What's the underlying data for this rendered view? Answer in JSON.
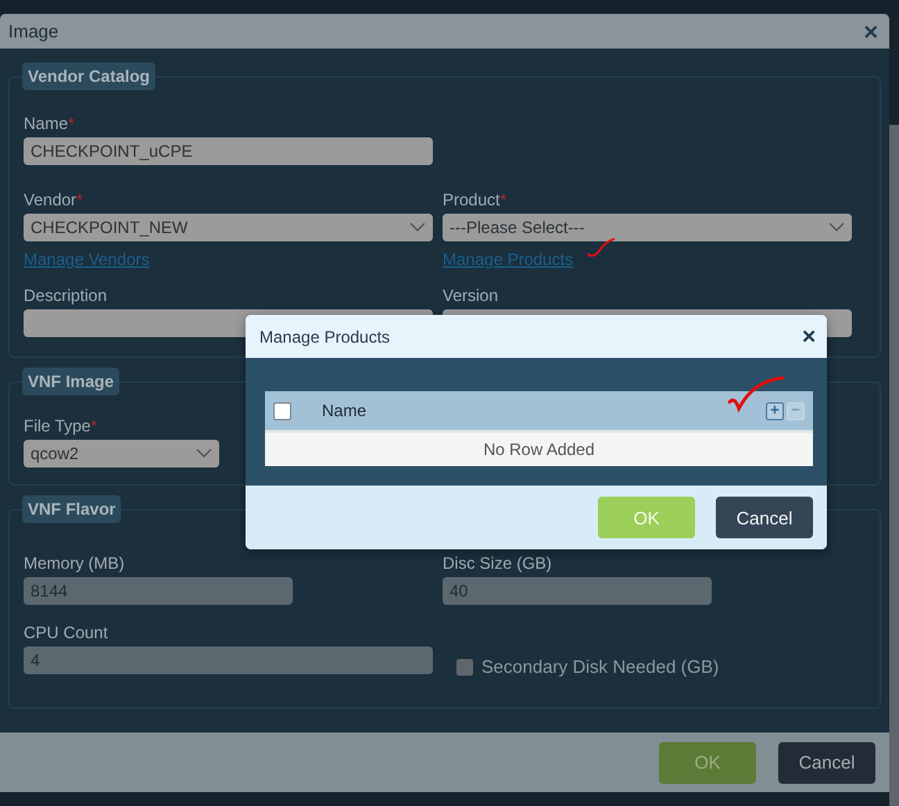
{
  "dialog": {
    "title": "Image",
    "close": "×",
    "sections": [
      {
        "legend": "Vendor Catalog",
        "rows": [
          [
            {
              "kind": "input",
              "label": "Name",
              "required_mark": "*",
              "value": "CHECKPOINT_uCPE"
            }
          ],
          [
            {
              "kind": "select",
              "label": "Vendor",
              "required_mark": "*",
              "value": "CHECKPOINT_NEW",
              "link": "Manage Vendors"
            },
            {
              "kind": "select",
              "label": "Product",
              "required_mark": "*",
              "value": "---Please Select---",
              "link": "Manage Products"
            }
          ],
          [
            {
              "kind": "input",
              "label": "Description"
            },
            {
              "kind": "input",
              "label": "Version"
            }
          ]
        ]
      },
      {
        "legend": "VNF Image",
        "rows": [
          [
            {
              "kind": "select",
              "label": "File Type",
              "required_mark": "*",
              "value": "qcow2"
            }
          ]
        ]
      },
      {
        "legend": "VNF Flavor",
        "rows": [
          [
            {
              "kind": "input",
              "label": "Memory (MB)",
              "value": "8144"
            },
            {
              "kind": "input",
              "label": "Disc Size (GB)",
              "value": "40"
            }
          ],
          [
            {
              "kind": "input",
              "label": "CPU Count",
              "value": "4"
            },
            {
              "kind": "checkbox",
              "label": "Secondary Disk Needed (GB)",
              "checked": false
            }
          ]
        ]
      }
    ],
    "buttons": [
      {
        "kind": "primary",
        "label": "OK"
      },
      {
        "kind": "secondary",
        "label": "Cancel"
      }
    ]
  },
  "modal": {
    "title": "Manage Products",
    "close": "×",
    "table": {
      "select_all": {
        "checked": false
      },
      "columns": [
        "Name"
      ],
      "add": "+",
      "remove": "−",
      "empty_text": "No Row Added"
    },
    "buttons": [
      {
        "kind": "primary",
        "label": "OK"
      },
      {
        "kind": "secondary",
        "label": "Cancel"
      }
    ]
  }
}
